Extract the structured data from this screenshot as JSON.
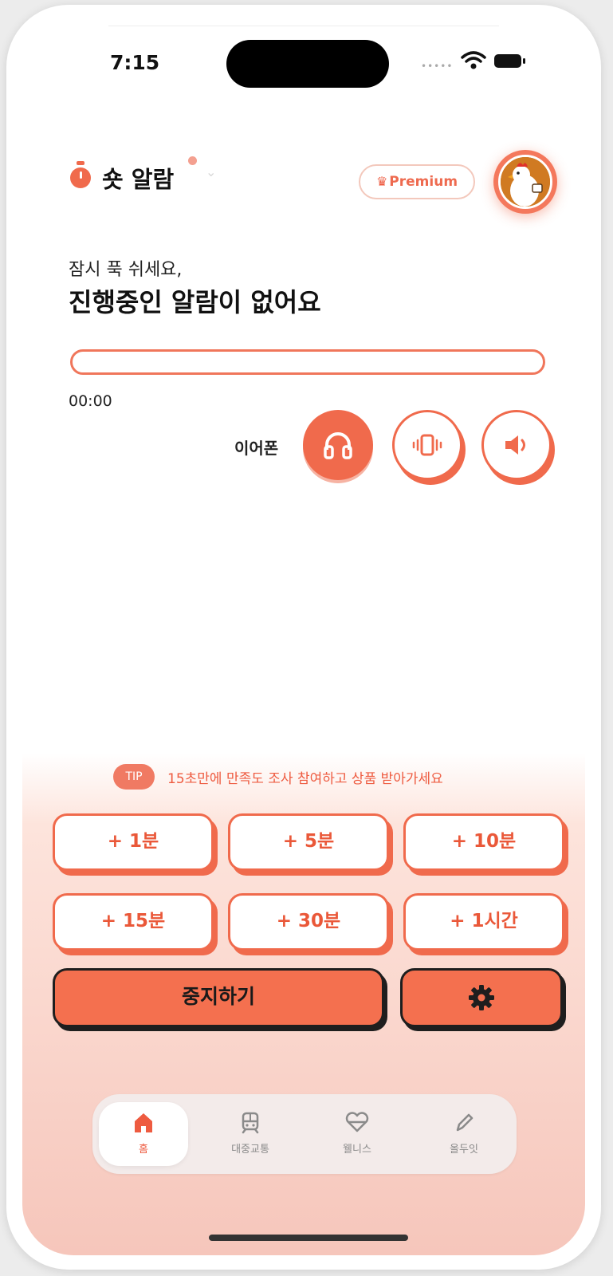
{
  "status_bar": {
    "time": "7:15"
  },
  "header": {
    "title": "숏 알람",
    "premium_label": "Premium"
  },
  "alarm": {
    "subtitle": "잠시 푹 쉬세요,",
    "headline": "진행중인 알람이 없어요",
    "progress": 0,
    "elapsed": "00:00"
  },
  "output": {
    "label": "이어폰",
    "modes": [
      {
        "icon": "headphones-icon",
        "active": true
      },
      {
        "icon": "vibration-icon",
        "active": false
      },
      {
        "icon": "speaker-icon",
        "active": false
      }
    ]
  },
  "tip": {
    "badge": "TIP",
    "text": "15초만에 만족도 조사 참여하고 상품 받아가세요"
  },
  "add_time_buttons": [
    "+ 1분",
    "+ 5분",
    "+ 10분",
    "+ 15분",
    "+ 30분",
    "+ 1시간"
  ],
  "actions": {
    "stop_label": "중지하기"
  },
  "tabbar": {
    "items": [
      {
        "label": "홈",
        "icon": "home-icon",
        "active": true
      },
      {
        "label": "대중교통",
        "icon": "train-icon",
        "active": false
      },
      {
        "label": "웰니스",
        "icon": "heart-icon",
        "active": false
      },
      {
        "label": "올두잇",
        "icon": "pencil-icon",
        "active": false
      }
    ]
  },
  "colors": {
    "accent": "#f06a4c",
    "accent_light": "#fde4dc",
    "text": "#111111"
  }
}
